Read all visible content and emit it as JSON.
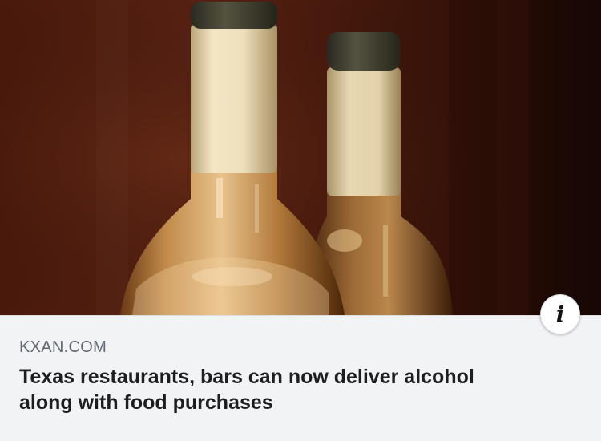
{
  "link_preview": {
    "image": {
      "subject": "two-wine-bottles",
      "colors": {
        "background": "#3a1208",
        "foil": "#ead9b4",
        "cap": "#3c3a30",
        "glass": "#c9934e"
      }
    },
    "info_icon": "info-icon",
    "source_domain": "KXAN.COM",
    "headline_lines": [
      "Texas restaurants, bars can now deliver alcohol",
      "along with food purchases"
    ],
    "colors": {
      "caption_background": "#f2f3f5",
      "source_text": "#606770",
      "headline_text": "#1c1e21"
    }
  }
}
